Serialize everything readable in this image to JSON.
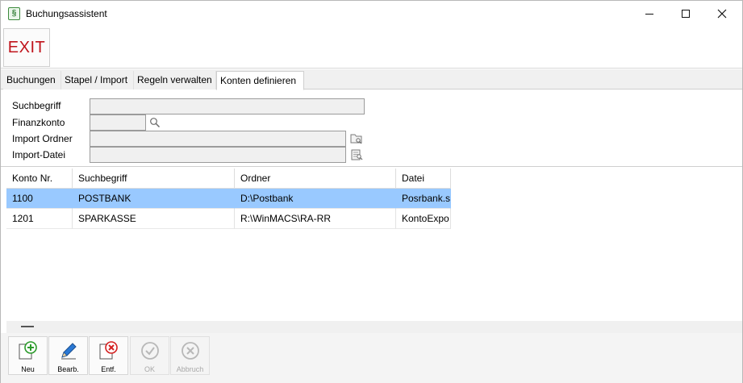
{
  "window": {
    "title": "Buchungsassistent",
    "icon_glyph": "§",
    "icon_name": "app-icon"
  },
  "toolbar": {
    "exit_label": "EXIT",
    "exit_color": "#c0141c"
  },
  "tabs": [
    {
      "label": "Buchungen",
      "active": false
    },
    {
      "label": "Stapel / Import",
      "active": false
    },
    {
      "label": "Regeln verwalten",
      "active": false
    },
    {
      "label": "Konten definieren",
      "active": true
    }
  ],
  "form": {
    "suchbegriff_label": "Suchbegriff",
    "suchbegriff_value": "",
    "finanzkonto_label": "Finanzkonto",
    "finanzkonto_value": "",
    "import_ordner_label": "Import Ordner",
    "import_ordner_value": "",
    "import_datei_label": "Import-Datei",
    "import_datei_value": ""
  },
  "grid": {
    "columns": [
      "Konto Nr.",
      "Suchbegriff",
      "Ordner",
      "Datei"
    ],
    "rows": [
      {
        "konto": "1100",
        "suchbegriff": "POSTBANK",
        "ordner": "D:\\Postbank",
        "datei": "Posrbank.s",
        "selected": true
      },
      {
        "konto": "1201",
        "suchbegriff": "SPARKASSE",
        "ordner": "R:\\WinMACS\\RA-RR",
        "datei": "KontoExpo",
        "selected": false
      }
    ],
    "selection_color": "#99c9ff"
  },
  "bottom": {
    "new_label": "Neu",
    "edit_label": "Bearb.",
    "delete_label": "Entf.",
    "ok_label": "OK",
    "cancel_label": "Abbruch"
  }
}
